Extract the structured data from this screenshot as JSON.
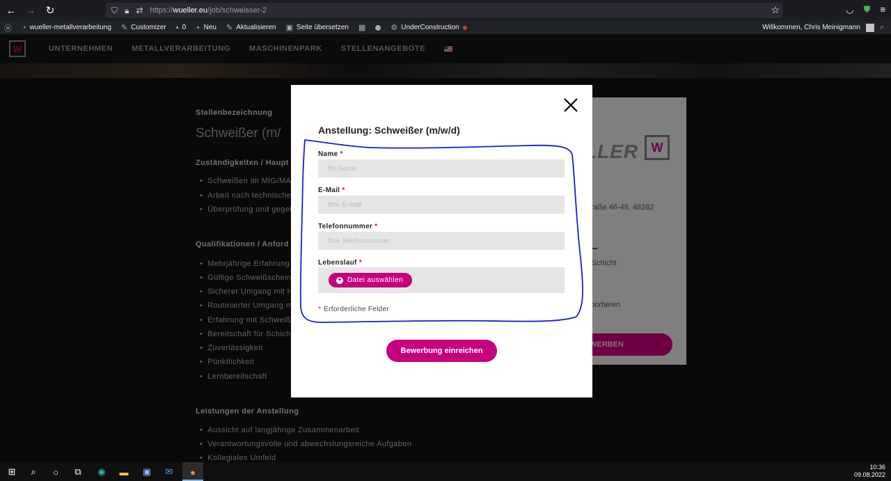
{
  "browser": {
    "url_prefix": "https://",
    "url_domain": "wueller.eu",
    "url_path": "/job/schweisser-2"
  },
  "wp_admin_bar": {
    "site_name": "wueller-metallverarbeitung",
    "customizer": "Customizer",
    "comments_count": "0",
    "new": "Neu",
    "update": "Aktualisieren",
    "translate": "Seite übersetzen",
    "under_construction": "UnderConstruction",
    "welcome": "Willkommen, Chris Meinigmann"
  },
  "site_nav": {
    "logo": "W",
    "items": [
      "UNTERNEHMEN",
      "METALLVERARBEITUNG",
      "MASCHINENPARK",
      "STELLENANGEBOTE"
    ]
  },
  "job": {
    "title_label": "Stellenbezeichnung",
    "title": "Schweißer (m/",
    "duties_heading": "Zuständigkeiten / Haupt",
    "duties": [
      "Schweißen im MIG/MAG",
      "Arbeit nach technischer",
      "Überprüfung und gegeb"
    ],
    "qual_heading": "Qualifikationen / Anford",
    "quals": [
      "Mehrjährige Erfahrung",
      "Gültige Schweißscheine",
      "Sicherer Umgang mit Ha",
      "Routinierter Umgang m",
      "Erfahrung mit Schweiß",
      "Bereitschaft für Schich",
      "Zuverlässigkeit",
      "Pünktlichkeit",
      "Lernbereitschaft"
    ],
    "benefits_heading": "Leistungen der Anstellung",
    "benefits": [
      "Aussicht auf langjährige Zusammenarbeit",
      "Verantwortungsvolle und abwechslungsreiche Aufgaben",
      "Kollegiales Umfeld"
    ]
  },
  "sidebar": {
    "brand": "LLER",
    "brand_mark": "W",
    "address": "raße 46-48, 48282",
    "shift": "-Schicht",
    "transport": "portieren",
    "apply_button": "T BEWERBEN"
  },
  "modal": {
    "title": "Anstellung: Schweißer (m/w/d)",
    "fields": [
      {
        "label": "Name",
        "placeholder": "Ihr Name"
      },
      {
        "label": "E-Mail",
        "placeholder": "Ihre E-mail"
      },
      {
        "label": "Telefonnummer",
        "placeholder": "Ihre Telefonnummer"
      }
    ],
    "cv_label": "Lebenslauf",
    "file_button": "Datei auswählen",
    "required_marker": "*",
    "required_note": "Erforderliche Felder",
    "submit": "Bewerbung einreichen"
  },
  "taskbar": {
    "time": "10:36",
    "date": "09.08.2022"
  },
  "colors": {
    "accent": "#c7007d",
    "annotation": "#1a1adc"
  }
}
